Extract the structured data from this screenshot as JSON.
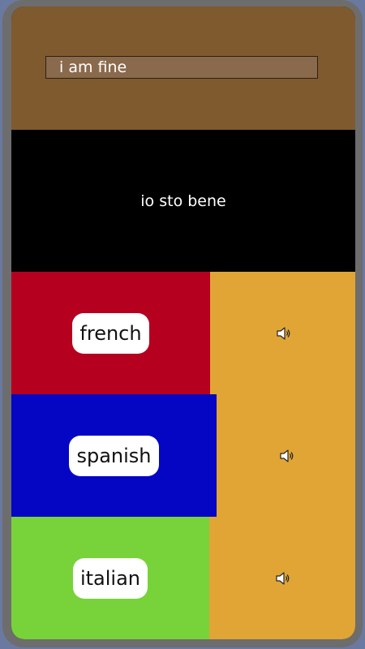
{
  "input": {
    "value": "i am fine"
  },
  "output": {
    "text": "io sto bene"
  },
  "languages": [
    {
      "label": "french",
      "color": "#b5001f",
      "icon": "speaker-icon"
    },
    {
      "label": "spanish",
      "color": "#0406c4",
      "icon": "speaker-icon"
    },
    {
      "label": "italian",
      "color": "#78d33a",
      "icon": "speaker-icon"
    }
  ],
  "colors": {
    "input_panel": "#7f5a2f",
    "output_panel": "#000000",
    "speak_cell": "#e0a535"
  }
}
